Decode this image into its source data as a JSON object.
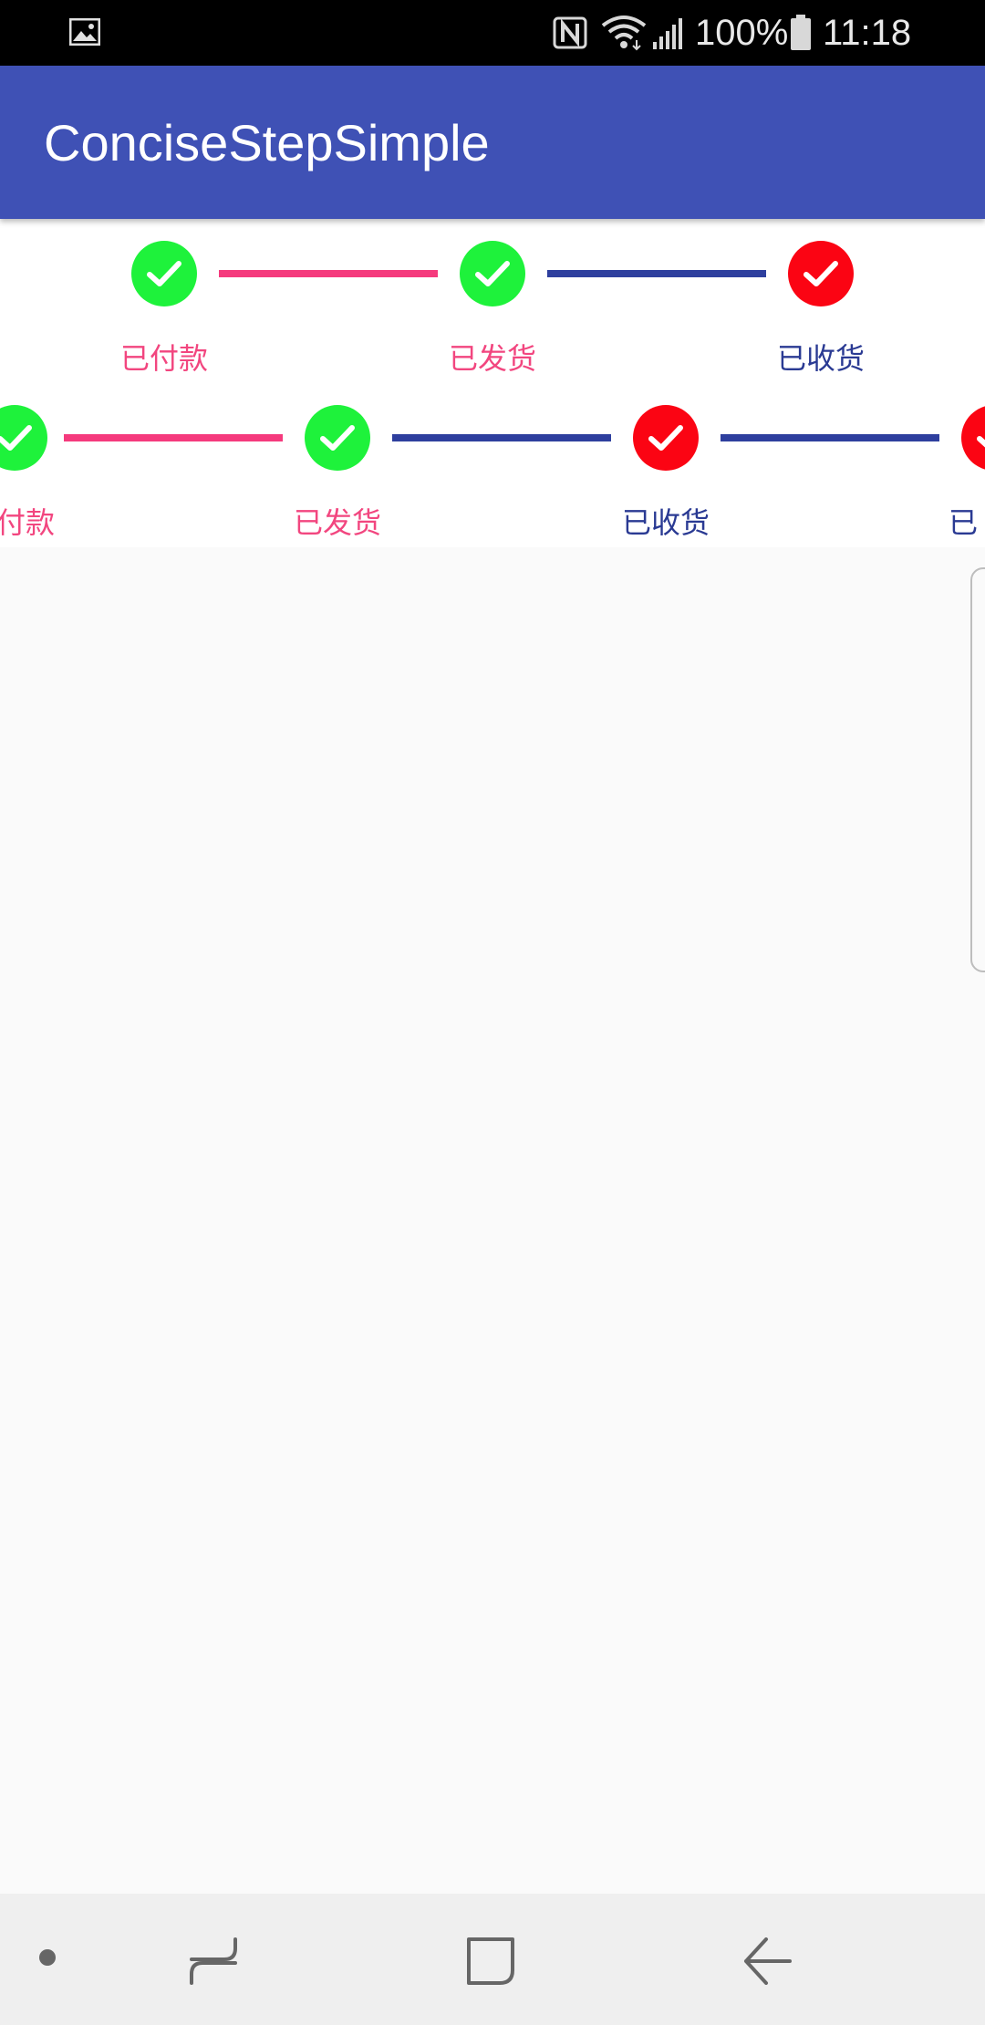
{
  "status_bar": {
    "battery": "100%",
    "time": "11:18",
    "icons": [
      "image-icon",
      "nfc-icon",
      "wifi-icon",
      "signal-icon",
      "battery-icon"
    ]
  },
  "app_bar": {
    "title": "ConciseStepSimple",
    "color": "#3f51b5"
  },
  "colors": {
    "done_node": "#1ef23b",
    "current_node": "#fb0413",
    "done_line": "#f53a7d",
    "todo_line": "#2e3f9e",
    "done_label": "#f2467f",
    "current_label": "#2a3a93"
  },
  "stepper1": {
    "steps": [
      {
        "label": "已付款",
        "state": "done"
      },
      {
        "label": "已发货",
        "state": "done"
      },
      {
        "label": "已收货",
        "state": "current"
      }
    ]
  },
  "stepper2": {
    "steps": [
      {
        "label": "付款",
        "state": "done"
      },
      {
        "label": "已发货",
        "state": "done"
      },
      {
        "label": "已收货",
        "state": "current"
      },
      {
        "label": "已",
        "state": "current"
      }
    ]
  },
  "nav_bar": {
    "buttons": [
      "dot-icon",
      "recent-apps-icon",
      "home-icon",
      "back-icon"
    ]
  }
}
